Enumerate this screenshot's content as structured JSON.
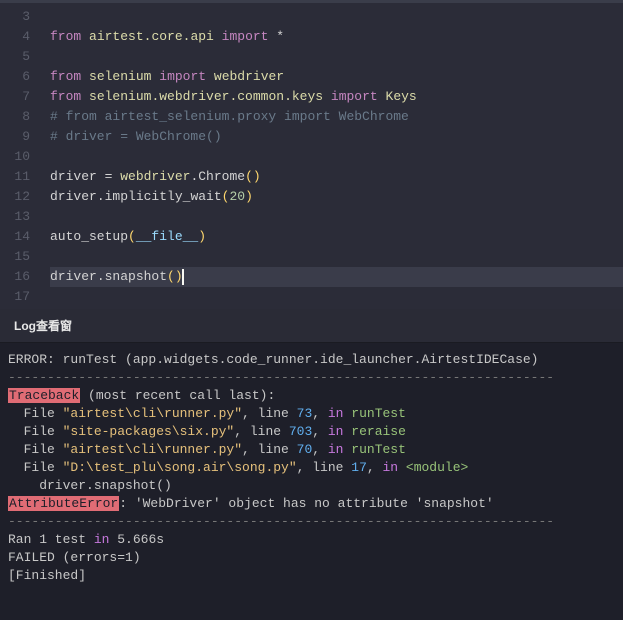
{
  "editor": {
    "lines": [
      {
        "n": 3,
        "seg": []
      },
      {
        "n": 4,
        "seg": [
          [
            "kw-from",
            "from"
          ],
          [
            "op",
            " "
          ],
          [
            "mod",
            "airtest.core.api"
          ],
          [
            "op",
            " "
          ],
          [
            "kw-import",
            "import"
          ],
          [
            "op",
            " "
          ],
          [
            "star",
            "*"
          ]
        ]
      },
      {
        "n": 5,
        "seg": []
      },
      {
        "n": 6,
        "seg": [
          [
            "kw-from",
            "from"
          ],
          [
            "op",
            " "
          ],
          [
            "mod",
            "selenium"
          ],
          [
            "op",
            " "
          ],
          [
            "kw-import",
            "import"
          ],
          [
            "op",
            " "
          ],
          [
            "mod",
            "webdriver"
          ]
        ]
      },
      {
        "n": 7,
        "seg": [
          [
            "kw-from",
            "from"
          ],
          [
            "op",
            " "
          ],
          [
            "mod",
            "selenium.webdriver.common.keys"
          ],
          [
            "op",
            " "
          ],
          [
            "kw-import",
            "import"
          ],
          [
            "op",
            " "
          ],
          [
            "mod",
            "Keys"
          ]
        ]
      },
      {
        "n": 8,
        "seg": [
          [
            "comment",
            "# from airtest_selenium.proxy import WebChrome"
          ]
        ]
      },
      {
        "n": 9,
        "seg": [
          [
            "comment",
            "# driver = WebChrome()"
          ]
        ]
      },
      {
        "n": 10,
        "seg": []
      },
      {
        "n": 11,
        "seg": [
          [
            "ident",
            "driver "
          ],
          [
            "op",
            "= "
          ],
          [
            "mod",
            "webdriver"
          ],
          [
            "op",
            "."
          ],
          [
            "call",
            "Chrome"
          ],
          [
            "paren",
            "()"
          ]
        ]
      },
      {
        "n": 12,
        "seg": [
          [
            "ident",
            "driver"
          ],
          [
            "op",
            "."
          ],
          [
            "call",
            "implicitly_wait"
          ],
          [
            "paren",
            "("
          ],
          [
            "num",
            "20"
          ],
          [
            "paren",
            ")"
          ]
        ]
      },
      {
        "n": 13,
        "seg": []
      },
      {
        "n": 14,
        "seg": [
          [
            "call",
            "auto_setup"
          ],
          [
            "paren",
            "("
          ],
          [
            "dunder",
            "__file__"
          ],
          [
            "paren",
            ")"
          ]
        ]
      },
      {
        "n": 15,
        "seg": []
      },
      {
        "n": 16,
        "hl": true,
        "seg": [
          [
            "ident",
            "driver"
          ],
          [
            "op",
            "."
          ],
          [
            "call",
            "snapshot"
          ],
          [
            "paren",
            "("
          ],
          [
            "paren",
            ")"
          ]
        ],
        "cursor": true
      },
      {
        "n": 17,
        "seg": []
      }
    ]
  },
  "panel": {
    "title": "Log查看窗"
  },
  "log": {
    "error_line": "ERROR: runTest (app.widgets.code_runner.ide_launcher.AirtestIDECase)",
    "dash": "----------------------------------------------------------------------",
    "traceback_label": "Traceback",
    "traceback_rest": " (most recent call last):",
    "frames": [
      {
        "file": "\"airtest\\cli\\runner.py\"",
        "line": "73",
        "in": "runTest"
      },
      {
        "file": "\"site-packages\\six.py\"",
        "line": "703",
        "in": "reraise"
      },
      {
        "file": "\"airtest\\cli\\runner.py\"",
        "line": "70",
        "in": "runTest"
      },
      {
        "file": "\"D:\\test_plu\\song.air\\song.py\"",
        "line": "17",
        "in": "<module>"
      }
    ],
    "code_context": "    driver.snapshot()",
    "attr_label": "AttributeError",
    "attr_rest": ": 'WebDriver' object has no attribute 'snapshot'",
    "ran": "Ran 1 test ",
    "in_kw": "in",
    "time": " 5.666s",
    "failed": "FAILED (errors=1)",
    "finished": "[Finished]"
  }
}
